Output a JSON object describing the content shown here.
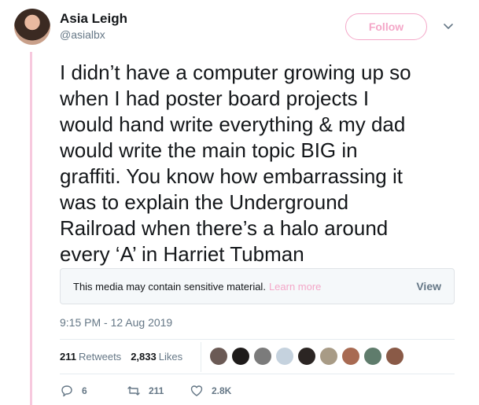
{
  "user": {
    "name": "Asia Leigh",
    "handle": "@asialbx"
  },
  "follow_button": {
    "label": "Follow"
  },
  "tweet": {
    "text": "I didn’t have a computer growing up so\nwhen I had poster board projects I\nwould hand write everything & my dad\nwould write the main topic BIG in\ngraffiti. You know how embarrassing it\nwas to explain the Underground\nRailroad when there’s a halo around\nevery ‘A’ in Harriet Tubman",
    "timestamp": "9:15 PM - 12 Aug 2019"
  },
  "sensitive_media": {
    "message": "This media may contain sensitive material.",
    "learn_more": "Learn more",
    "view_label": "View"
  },
  "stats": {
    "retweets_count": "211",
    "retweets_label": "Retweets",
    "likes_count": "2,833",
    "likes_label": "Likes"
  },
  "likers": [
    {
      "icon": "liker-avatar-1",
      "color": "#6b5a55"
    },
    {
      "icon": "liker-avatar-2",
      "color": "#1e1b1a"
    },
    {
      "icon": "liker-avatar-3",
      "color": "#7b7b7b"
    },
    {
      "icon": "default-egg-avatar",
      "color": "#c5d2de"
    },
    {
      "icon": "liker-avatar-5",
      "color": "#2b2523"
    },
    {
      "icon": "liker-avatar-6",
      "color": "#a89b86"
    },
    {
      "icon": "liker-avatar-7",
      "color": "#a86a52"
    },
    {
      "icon": "liker-avatar-8",
      "color": "#5f7c6c"
    },
    {
      "icon": "liker-avatar-9",
      "color": "#8a5a47"
    }
  ],
  "actions": {
    "reply_count": "6",
    "retweet_count": "211",
    "like_count": "2.8K"
  },
  "colors": {
    "accent": "#f4a7c8",
    "thread_line": "#f7c9de",
    "secondary_text": "#657786"
  }
}
